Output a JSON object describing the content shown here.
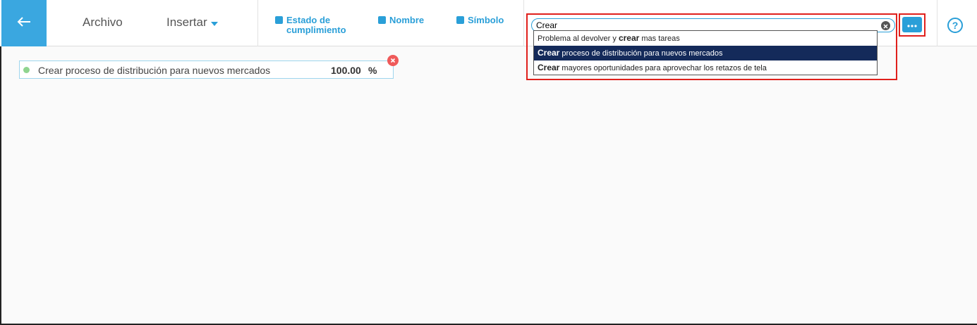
{
  "toolbar": {
    "back_icon": "arrow-left-icon",
    "file_label": "Archivo",
    "insert_label": "Insertar",
    "toggles": [
      {
        "line1": "Estado de",
        "line2": "cumplimiento"
      },
      {
        "line1": "Nombre",
        "line2": ""
      },
      {
        "line1": "Símbolo",
        "line2": ""
      }
    ],
    "accent_color": "#2a9fd8"
  },
  "search": {
    "value": "Crear",
    "suggestions": [
      {
        "before": "Problema al devolver y ",
        "match": "crear",
        "after": " mas tareas",
        "selected": false
      },
      {
        "before": "",
        "match": "Crear",
        "after": " proceso de distribución para nuevos mercados",
        "selected": true
      },
      {
        "before": "",
        "match": "Crear",
        "after": " mayores oportunidades para aprovechar los retazos de tela",
        "selected": false
      }
    ]
  },
  "card": {
    "title": "Crear proceso de distribución para nuevos mercados",
    "value": "100.00",
    "unit": "%",
    "status_color": "#8fd48f"
  }
}
